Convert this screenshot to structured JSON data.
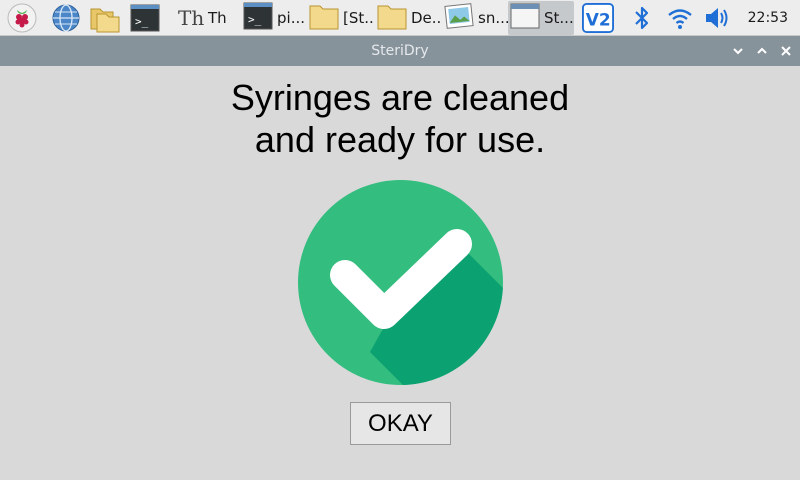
{
  "taskbar": {
    "tasks": [
      {
        "label": "Th",
        "icon": "thonny-icon"
      },
      {
        "label": "pi...",
        "icon": "terminal-icon"
      },
      {
        "label": "[St...",
        "icon": "folder-icon"
      },
      {
        "label": "De...",
        "icon": "folder-icon"
      },
      {
        "label": "sn...",
        "icon": "image-viewer-icon"
      },
      {
        "label": "St...",
        "icon": "window-icon"
      }
    ],
    "clock": "22:53"
  },
  "window": {
    "title": "SteriDry"
  },
  "dialog": {
    "message_line1": "Syringes are cleaned",
    "message_line2": "and ready for use.",
    "okay_label": "OKAY"
  },
  "colors": {
    "check_circle": "#33bd7f",
    "check_shadow": "#0ba170",
    "titlebar": "#87939b"
  }
}
